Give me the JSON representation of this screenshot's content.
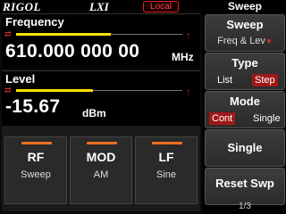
{
  "topbar": {
    "brand": "RIGOL",
    "lxi": "LXI",
    "status": "Local"
  },
  "frequency": {
    "label": "Frequency",
    "value": "610.000 000 00",
    "unit": "MHz"
  },
  "level": {
    "label": "Level",
    "value": "-15.67",
    "unit": "dBm"
  },
  "tiles": [
    {
      "name": "RF",
      "value": "Sweep"
    },
    {
      "name": "MOD",
      "value": "AM"
    },
    {
      "name": "LF",
      "value": "Sine"
    }
  ],
  "menu": {
    "title": "Sweep",
    "sweep": {
      "title": "Sweep",
      "sub": "Freq & Lev"
    },
    "type": {
      "title": "Type",
      "opt1": "List",
      "opt2": "Step",
      "selected": "Step"
    },
    "mode": {
      "title": "Mode",
      "opt1": "Cont",
      "opt2": "Single",
      "selected": "Cont"
    },
    "single": {
      "title": "Single"
    },
    "reset": {
      "title": "Reset Swp"
    },
    "page": "1/3"
  },
  "colors": {
    "accent": "#ffe000",
    "alert": "#e23030",
    "led": "#f07020",
    "selected": "#a01818"
  }
}
